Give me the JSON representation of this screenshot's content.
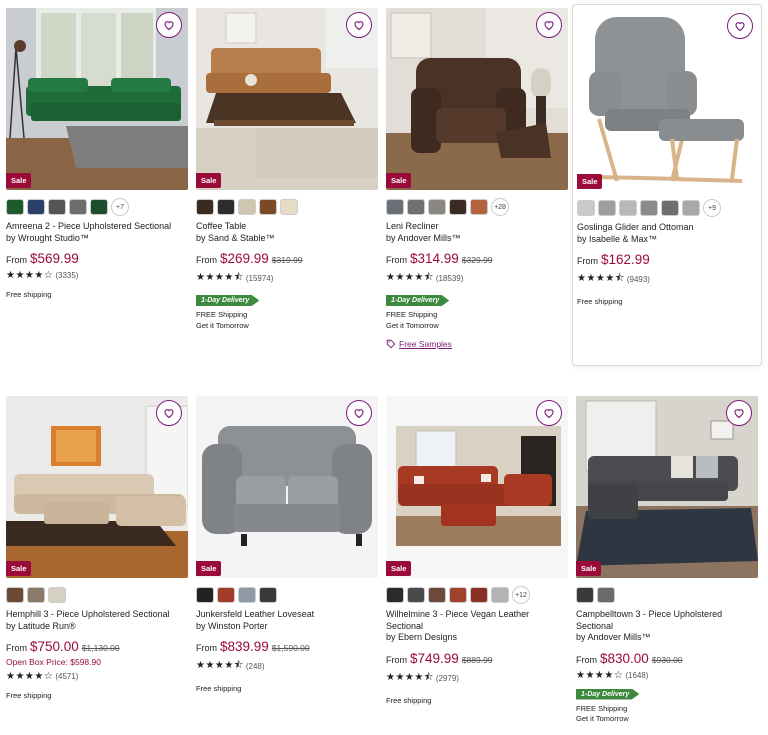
{
  "products": [
    {
      "name_line1": "Amreena 2 - Piece Upholstered Sectional",
      "name_line2": "by Wrought Studio™",
      "name_line3": "",
      "from": "From",
      "price": "$569.99",
      "was": "",
      "open_box": "",
      "stars": "★★★★☆",
      "rating": 4,
      "count": "(3335)",
      "shipping": "Free shipping",
      "delivery_badge": "",
      "free_shipping": "",
      "get_it": "",
      "samples": "",
      "sale_label": "Sale",
      "swatches": [
        "#1f5a2e",
        "#2b3f6b",
        "#555555",
        "#6d6d6d",
        "#1e4f2d"
      ],
      "more": "+7",
      "hovered": false
    },
    {
      "name_line1": "Coffee Table",
      "name_line2": "by Sand & Stable™",
      "name_line3": "",
      "from": "From",
      "price": "$269.99",
      "was": "$319.99",
      "open_box": "",
      "stars": "★★★★⯪",
      "rating": 4.5,
      "count": "(15974)",
      "shipping": "",
      "delivery_badge": "1-Day Delivery",
      "free_shipping": "FREE Shipping",
      "get_it": "Get it Tomorrow",
      "samples": "",
      "sale_label": "Sale",
      "swatches": [
        "#3b2a20",
        "#2d2d2d",
        "#cfc6b0",
        "#7a4a26",
        "#e6dcc6"
      ],
      "more": "",
      "hovered": false
    },
    {
      "name_line1": "Leni Recliner",
      "name_line2": "by Andover Mills™",
      "name_line3": "",
      "from": "From",
      "price": "$314.99",
      "was": "$329.99",
      "open_box": "",
      "stars": "★★★★⯪",
      "rating": 4.5,
      "count": "(18539)",
      "shipping": "",
      "delivery_badge": "1-Day Delivery",
      "free_shipping": "FREE Shipping",
      "get_it": "Get it Tomorrow",
      "samples": "Free Samples",
      "sale_label": "Sale",
      "swatches": [
        "#6b6f78",
        "#707070",
        "#8a8680",
        "#3c2b22",
        "#b5623e"
      ],
      "more": "+28",
      "hovered": false
    },
    {
      "name_line1": "Goslinga Glider and Ottoman",
      "name_line2": "by Isabelle & Max™",
      "name_line3": "",
      "from": "From",
      "price": "$162.99",
      "was": "",
      "open_box": "",
      "stars": "★★★★⯪",
      "rating": 4.5,
      "count": "(9493)",
      "shipping": "Free shipping",
      "delivery_badge": "",
      "free_shipping": "",
      "get_it": "",
      "samples": "",
      "sale_label": "Sale",
      "swatches": [
        "#c9c9c9",
        "#9e9e9e",
        "#b8b8b8",
        "#8a8a8a",
        "#6e6e6e",
        "#a9a9a9"
      ],
      "more": "+9",
      "hovered": true
    },
    {
      "name_line1": "Hemphill 3 - Piece Upholstered Sectional",
      "name_line2": "by Latitude Run®",
      "name_line3": "",
      "from": "From",
      "price": "$750.00",
      "was": "$1,130.00",
      "open_box": "Open Box Price: $598.90",
      "stars": "★★★★☆",
      "rating": 4,
      "count": "(4571)",
      "shipping": "Free shipping",
      "delivery_badge": "",
      "free_shipping": "",
      "get_it": "",
      "samples": "",
      "sale_label": "Sale",
      "swatches": [
        "#6a4a35",
        "#8a7a6a",
        "#d6cfc3"
      ],
      "more": "",
      "hovered": false
    },
    {
      "name_line1": "Junkersfeld Leather Loveseat",
      "name_line2": "by Winston Porter",
      "name_line3": "",
      "from": "From",
      "price": "$839.99",
      "was": "$1,590.00",
      "open_box": "",
      "stars": "★★★★⯪",
      "rating": 4.5,
      "count": "(248)",
      "shipping": "Free shipping",
      "delivery_badge": "",
      "free_shipping": "",
      "get_it": "",
      "samples": "",
      "sale_label": "Sale",
      "swatches": [
        "#222222",
        "#a33a2a",
        "#8e9aa6",
        "#3a3a3a"
      ],
      "more": "",
      "hovered": false
    },
    {
      "name_line1": "Wilhelmine 3 - Piece Vegan Leather Sectional",
      "name_line2": "by Ebern Designs",
      "name_line3": "",
      "from": "From",
      "price": "$749.99",
      "was": "$889.99",
      "open_box": "",
      "stars": "★★★★⯪",
      "rating": 4.5,
      "count": "(2979)",
      "shipping": "Free shipping",
      "delivery_badge": "",
      "free_shipping": "",
      "get_it": "",
      "samples": "",
      "sale_label": "Sale",
      "swatches": [
        "#2b2b2b",
        "#4a4a4a",
        "#6b4a3a",
        "#a0422c",
        "#8c2f24",
        "#b3b3b3"
      ],
      "more": "+12",
      "hovered": false
    },
    {
      "name_line1": "Campbelltown 3 - Piece Upholstered",
      "name_line2": "Sectional",
      "name_line3": "by Andover Mills™",
      "from": "From",
      "price": "$830.00",
      "was": "$930.00",
      "open_box": "",
      "stars": "★★★★☆",
      "rating": 4,
      "count": "(1648)",
      "shipping": "",
      "delivery_badge": "1-Day Delivery",
      "free_shipping": "FREE Shipping",
      "get_it": "Get it Tomorrow",
      "samples": "",
      "sale_label": "Sale",
      "swatches": [
        "#3a3a3a",
        "#6b6b6b"
      ],
      "more": "",
      "hovered": false
    }
  ]
}
